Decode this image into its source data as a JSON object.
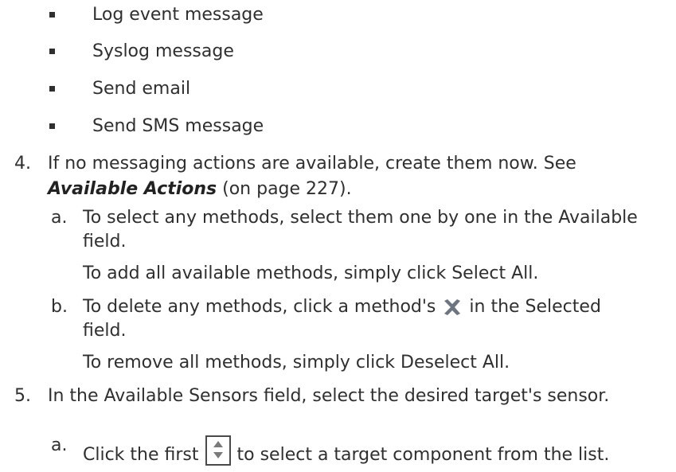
{
  "bullets": [
    "Log event message",
    "Syslog message",
    "Send email",
    "Send SMS message"
  ],
  "step4": {
    "number": "4.",
    "text1": "If no messaging actions are available, create them now. See",
    "link": "Available Actions",
    "text2": " (on page 227).",
    "a": {
      "letter": "a.",
      "text1": "To select any methods, select them one by one in the Available",
      "text2": "field.",
      "note": "To add all available methods, simply click Select All."
    },
    "b": {
      "letter": "b.",
      "text_before": "To delete any methods, click a method's ",
      "icon": "x-delete-icon",
      "text_after": " in the Selected",
      "text2": "field.",
      "note": "To remove all methods, simply click Deselect All."
    }
  },
  "step5": {
    "number": "5.",
    "text": "In the Available Sensors field, select the desired target's sensor.",
    "a": {
      "letter": "a.",
      "text_before": "Click the first ",
      "icon": "spinner-updown-icon",
      "text_after": " to select a target component from the list."
    }
  }
}
